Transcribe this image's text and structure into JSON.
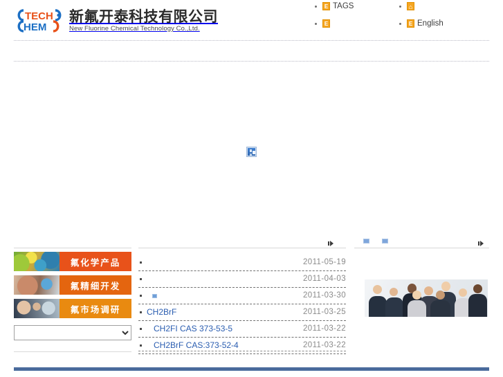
{
  "site": {
    "logo": {
      "mark_alt": "techchem-logo-mark",
      "name_cn": "新氟开泰科技有限公司",
      "name_cn_bold": "新氟开泰",
      "name_cn_rest": "科技有限公司",
      "name_en": "New Fluorine Chemical Technology Co.,Ltd."
    },
    "colors": {
      "logo_blue": "#1c6fc4",
      "logo_orange": "#e8521a",
      "link_blue": "#2a5db0",
      "footer_bar": "#4a6b9c",
      "promo_orange_1": "#e8521a",
      "promo_orange_2": "#e4650f",
      "promo_orange_3": "#e98a10",
      "broken_icon_orange": "#f5a623"
    }
  },
  "topnav": {
    "column1": [
      {
        "icon": "broken-image-icon",
        "icon_glyph": "E",
        "label": "TAGS"
      },
      {
        "icon": "broken-image-icon",
        "icon_glyph": "E",
        "label": ""
      }
    ],
    "column2": [
      {
        "icon": "home-icon",
        "icon_glyph": "⌂",
        "label": ""
      },
      {
        "icon": "broken-image-icon",
        "icon_glyph": "E",
        "label": "English"
      }
    ]
  },
  "banner": {
    "placeholder_icon": "broken-image-placeholder-icon"
  },
  "sidebar": {
    "promos": [
      {
        "label": "氟化学产品",
        "thumb": "chemistry-products-thumb"
      },
      {
        "label": "氟精细开发",
        "thumb": "fine-development-thumb"
      },
      {
        "label": "氟市场调研",
        "thumb": "market-research-thumb"
      }
    ],
    "select": {
      "value": "",
      "options": [
        ""
      ]
    }
  },
  "news": {
    "more_label": "",
    "items": [
      {
        "title": "",
        "date": "2011-05-19",
        "indent": false,
        "broken": false
      },
      {
        "title": "",
        "date": "2011-04-03",
        "indent": false,
        "broken": false
      },
      {
        "title": "",
        "date": "2011-03-30",
        "indent": false,
        "broken": true
      },
      {
        "title": "CH2BrF",
        "date": "2011-03-25",
        "indent": false,
        "broken": false
      },
      {
        "title": "CH2FI CAS 373-53-5",
        "date": "2011-03-22",
        "indent": true,
        "broken": false
      },
      {
        "title": "CH2BrF CAS:373-52-4",
        "date": "2011-03-22",
        "indent": true,
        "broken": false
      }
    ]
  },
  "rightcol": {
    "tabs": [
      {
        "label": "",
        "icon": "broken-image-icon"
      },
      {
        "label": "",
        "icon": "broken-image-icon"
      }
    ],
    "more_label": "",
    "photo_alt": "business-team-photo"
  }
}
